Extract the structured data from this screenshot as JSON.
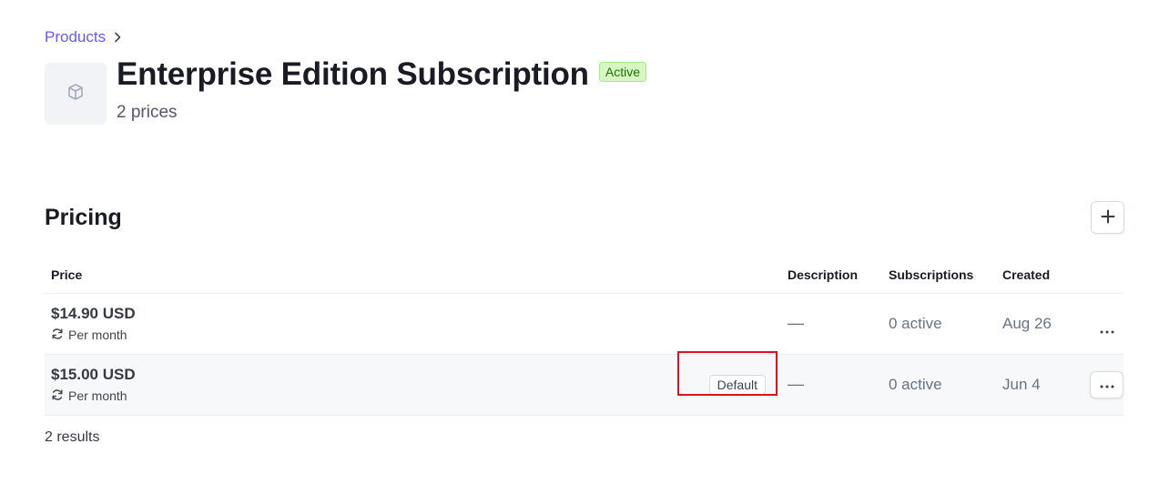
{
  "breadcrumb": {
    "products_label": "Products"
  },
  "product": {
    "title": "Enterprise Edition Subscription",
    "status": "Active",
    "subtitle": "2 prices",
    "thumb_icon": "box-icon"
  },
  "pricing": {
    "title": "Pricing",
    "add_icon": "plus-icon",
    "columns": {
      "price": "Price",
      "description": "Description",
      "subscriptions": "Subscriptions",
      "created": "Created"
    },
    "rows": [
      {
        "amount": "$14.90 USD",
        "interval": "Per month",
        "badge": "",
        "description": "—",
        "subscriptions": "0 active",
        "created": "Aug 26"
      },
      {
        "amount": "$15.00 USD",
        "interval": "Per month",
        "badge": "Default",
        "description": "—",
        "subscriptions": "0 active",
        "created": "Jun 4"
      }
    ],
    "results": "2 results"
  },
  "colors": {
    "accent": "#635bff",
    "active_badge_bg": "#d7f7c2",
    "active_badge_text": "#217005",
    "highlight": "#e0101e"
  }
}
